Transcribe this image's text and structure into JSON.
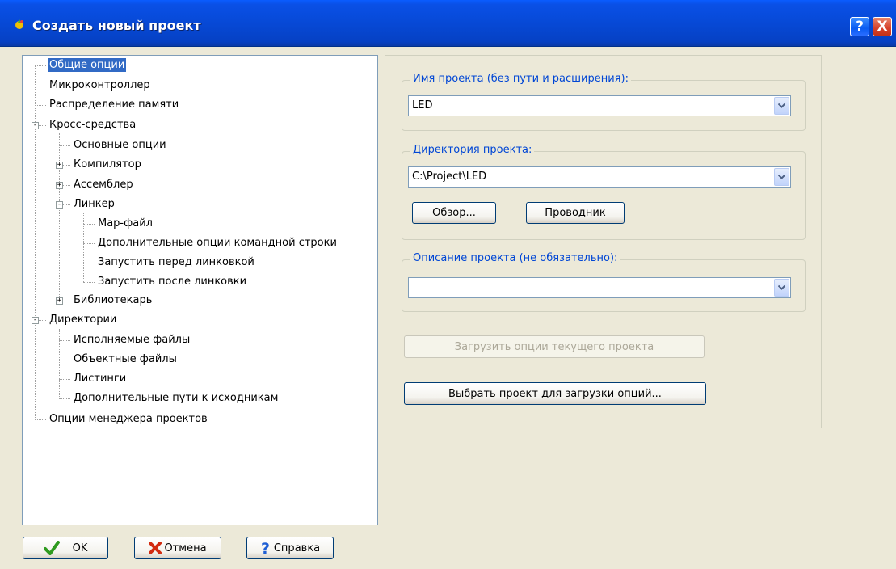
{
  "window": {
    "title": "Создать новый проект",
    "help_button": "?",
    "close_button": "X"
  },
  "tree": {
    "items": [
      {
        "label": "Общие опции",
        "selected": true
      },
      {
        "label": "Микроконтроллер"
      },
      {
        "label": "Распределение памяти"
      },
      {
        "label": "Кросс-средства",
        "expander": "-"
      },
      {
        "label": "Основные опции"
      },
      {
        "label": "Компилятор",
        "expander": "+"
      },
      {
        "label": "Ассемблер",
        "expander": "+"
      },
      {
        "label": "Линкер",
        "expander": "-"
      },
      {
        "label": "Map-файл"
      },
      {
        "label": "Дополнительные опции командной строки"
      },
      {
        "label": "Запустить перед линковкой"
      },
      {
        "label": "Запустить после линковки"
      },
      {
        "label": "Библиотекарь",
        "expander": "+"
      },
      {
        "label": "Директории",
        "expander": "-"
      },
      {
        "label": "Исполняемые файлы"
      },
      {
        "label": "Объектные файлы"
      },
      {
        "label": "Листинги"
      },
      {
        "label": "Дополнительные пути к исходникам"
      },
      {
        "label": "Опции менеджера проектов"
      }
    ]
  },
  "project_name": {
    "label": "Имя проекта (без пути и расширения):",
    "value": "LED"
  },
  "project_dir": {
    "label": "Директория проекта:",
    "value": "C:\\Project\\LED",
    "browse_label": "Обзор...",
    "explorer_label": "Проводник"
  },
  "project_desc": {
    "label": "Описание проекта (не обязательно):",
    "value": ""
  },
  "load_current_label": "Загрузить опции текущего проекта",
  "choose_project_label": "Выбрать проект для загрузки  опций...",
  "footer": {
    "ok_label": "OK",
    "cancel_label": "Отмена",
    "help_label": "Справка"
  }
}
